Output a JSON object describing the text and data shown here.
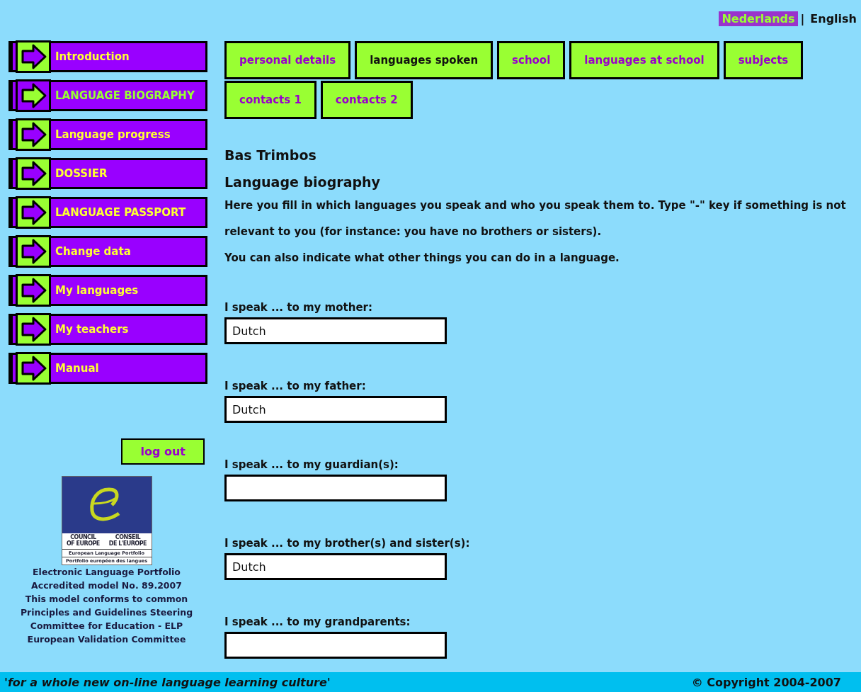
{
  "language_switch": [
    {
      "label": "Nederlands",
      "selected": true
    },
    {
      "label": "English",
      "selected": false
    }
  ],
  "language_separator": "|",
  "sidebar": {
    "items": [
      {
        "label": "Introduction",
        "selected": false
      },
      {
        "label": "LANGUAGE BIOGRAPHY",
        "selected": true
      },
      {
        "label": "Language progress",
        "selected": false
      },
      {
        "label": "DOSSIER",
        "selected": false
      },
      {
        "label": "LANGUAGE PASSPORT",
        "selected": false
      },
      {
        "label": "Change data",
        "selected": false
      },
      {
        "label": "My languages",
        "selected": false
      },
      {
        "label": "My teachers",
        "selected": false
      },
      {
        "label": "Manual",
        "selected": false
      }
    ],
    "logout": "log out",
    "logo": {
      "left": [
        "COUNCIL",
        "OF EUROPE"
      ],
      "right": [
        "CONSEIL",
        "DE L'EUROPE"
      ],
      "line1": "European Language Portfolio",
      "line2": "Portfolio européen des langues"
    },
    "accreditation": [
      "Electronic Language Portfolio",
      "Accredited model No. 89.2007",
      "This model conforms to common",
      "Principles and Guidelines Steering",
      "Committee for Education - ELP",
      "European Validation Committee"
    ]
  },
  "tabs": [
    {
      "label": "personal details",
      "selected": false
    },
    {
      "label": "languages spoken",
      "selected": true
    },
    {
      "label": "school",
      "selected": false
    },
    {
      "label": "languages at school",
      "selected": false
    },
    {
      "label": "subjects",
      "selected": false
    },
    {
      "label": "contacts 1",
      "selected": false
    },
    {
      "label": "contacts 2",
      "selected": false
    }
  ],
  "student_name": "Bas Trimbos",
  "heading": "Language biography",
  "intro": [
    "Here you fill in which languages you speak and who you speak them to. Type \"-\" key if something is not relevant to you (for instance: you have no brothers or sisters).",
    "You can also indicate what other things you can do in a language."
  ],
  "fields": [
    {
      "label": "I speak ... to my mother:",
      "value": "Dutch"
    },
    {
      "label": "I speak ... to my father:",
      "value": "Dutch"
    },
    {
      "label": "I speak ... to my guardian(s):"
    },
    {
      "label": "I speak ... to my brother(s) and sister(s):",
      "value": "Dutch"
    },
    {
      "label": "I speak ... to my grandparents:"
    }
  ],
  "footer": {
    "slogan": "'for a whole new on-line language learning culture'",
    "copyright": "© Copyright 2004-2007"
  }
}
